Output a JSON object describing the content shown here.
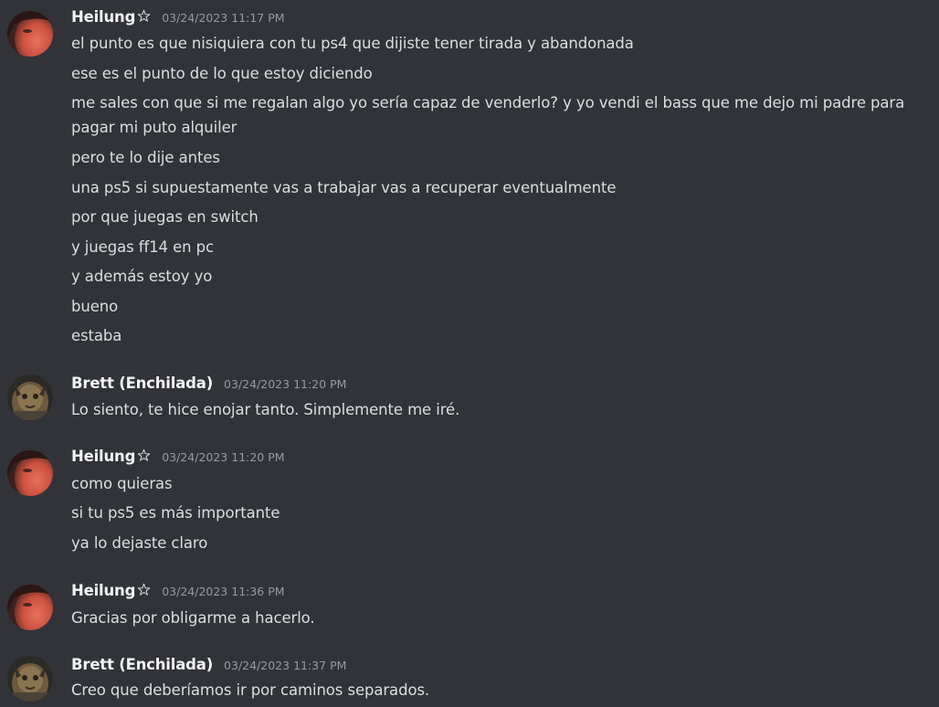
{
  "messages": [
    {
      "author": "Heilung",
      "timestamp": "03/24/2023 11:17 PM",
      "lines": [
        "el punto es que nisiquiera con tu ps4 que dijiste tener tirada y abandonada",
        "ese es el punto de lo que estoy diciendo",
        "me sales con que si me regalan algo yo sería capaz de venderlo? y yo vendi el bass que me dejo mi padre para",
        "pagar mi puto alquiler",
        "pero te lo dije antes",
        "una ps5 si supuestamente vas a trabajar vas a recuperar eventualmente",
        "por que juegas en switch",
        "y juegas ff14 en pc",
        "y además estoy yo",
        "bueno",
        "estaba"
      ]
    },
    {
      "author": "Brett (Enchilada)",
      "timestamp": "03/24/2023 11:20 PM",
      "lines": [
        "Lo siento, te hice enojar tanto. Simplemente me iré."
      ]
    },
    {
      "author": "Heilung",
      "timestamp": "03/24/2023 11:20 PM",
      "lines": [
        "como quieras",
        "si tu ps5 es más importante",
        "ya lo dejaste claro"
      ]
    },
    {
      "author": "Heilung",
      "timestamp": "03/24/2023 11:36 PM",
      "lines": [
        "Gracias por obligarme a hacerlo."
      ]
    },
    {
      "author": "Brett (Enchilada)",
      "timestamp": "03/24/2023 11:37 PM",
      "lines": [
        "Creo que deberíamos ir por caminos separados."
      ]
    }
  ],
  "colors": {
    "background": "#313338",
    "username": "#f2f3f5",
    "text": "#dbdee1",
    "timestamp": "#949ba4"
  },
  "icons": {
    "heilung_badge": "pentagram-star-icon"
  }
}
